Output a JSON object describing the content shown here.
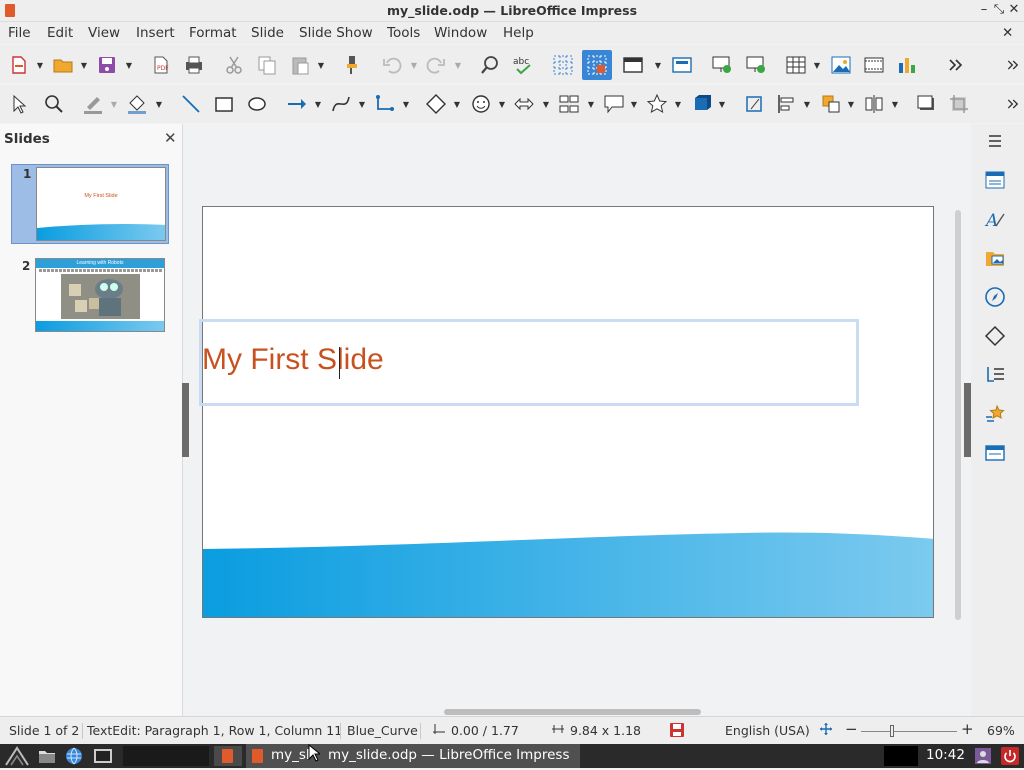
{
  "window": {
    "title": "my_slide.odp — LibreOffice Impress"
  },
  "menu": [
    "File",
    "Edit",
    "View",
    "Insert",
    "Format",
    "Slide",
    "Slide Show",
    "Tools",
    "Window",
    "Help"
  ],
  "slides_panel": {
    "header": "Slides",
    "close_glyph": "✕"
  },
  "slides": [
    {
      "number": "1",
      "title": "My First Slide"
    },
    {
      "number": "2",
      "title": "Learning with Robots"
    }
  ],
  "slide": {
    "title": "My First Slide"
  },
  "status": {
    "slide": "Slide 1 of 2",
    "edit": "TextEdit: Paragraph 1, Row 1, Column 11",
    "master": "Blue_Curve",
    "position": "0.00 / 1.77",
    "size": "9.84 x 1.18",
    "language": "English (USA)",
    "zoom": "69%"
  },
  "taskbar": {
    "task_short": "my_sl",
    "task_label": "my_slide.odp — LibreOffice Impress",
    "clock": "10:42"
  },
  "colors": {
    "accent": "#3a86d6",
    "title": "#c9511f",
    "wave": "#0a9de0",
    "taskbar": "#2a2a2a"
  }
}
